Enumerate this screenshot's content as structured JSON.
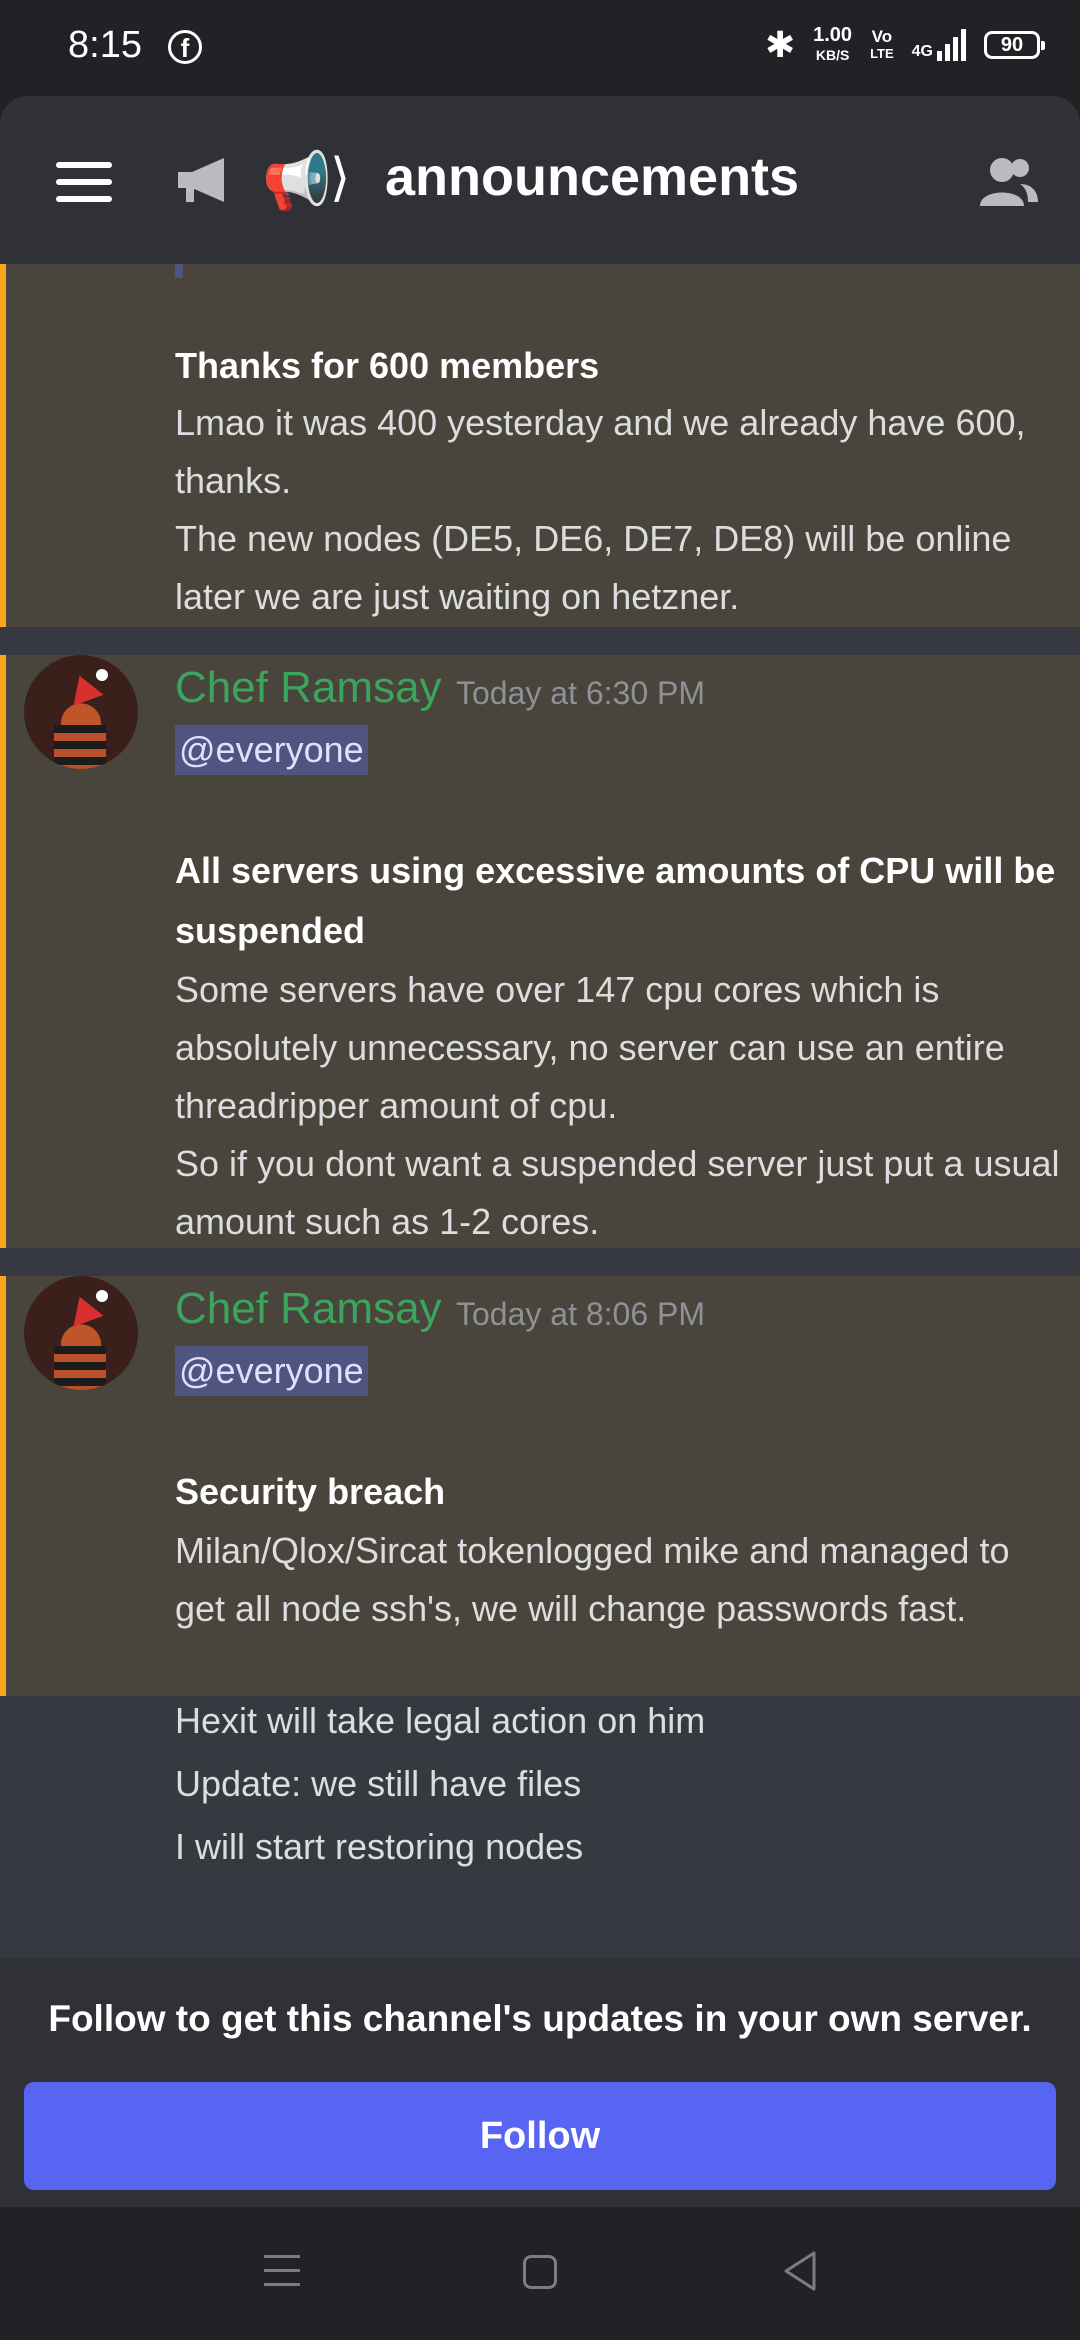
{
  "status_bar": {
    "time": "8:15",
    "fb_icon": "f",
    "speed_value": "1.00",
    "speed_unit": "KB/S",
    "volte_top": "Vo",
    "volte_bottom": "LTE",
    "network": "4G",
    "battery": "90"
  },
  "header": {
    "channel_emoji": "📢",
    "channel_chevron": "⟩",
    "channel_name": "announcements"
  },
  "messages": [
    {
      "partial": true,
      "bold": "Thanks for 600 members",
      "lines": [
        "Lmao it was 400 yesterday and we already have 600, thanks.",
        "The new nodes (DE5, DE6, DE7, DE8) will be online later we are just waiting on hetzner."
      ]
    },
    {
      "author": "Chef Ramsay",
      "timestamp": "Today at 6:30 PM",
      "mention": "@everyone",
      "bold": "All servers using excessive amounts of CPU will be suspended",
      "lines": [
        "Some servers have over 147 cpu cores which is absolutely unnecessary, no server can use an entire threadripper amount of cpu.",
        "So if you dont want a suspended server just put a usual amount such as 1-2 cores."
      ]
    },
    {
      "author": "Chef Ramsay",
      "timestamp": "Today at 8:06 PM",
      "mention": "@everyone",
      "bold": "Security breach",
      "lines": [
        "Milan/Qlox/Sircat tokenlogged mike and managed to get all node ssh's, we will change passwords fast.",
        "Hexit will take legal action on him",
        "Update: we still have files",
        "I will start restoring nodes"
      ]
    }
  ],
  "follow": {
    "prompt": "Follow to get this channel's updates in your own server.",
    "button_label": "Follow"
  },
  "icons": {
    "menu": "hamburger-icon",
    "announcement": "megaphone-icon",
    "members": "members-icon",
    "nav_menu": "recents-icon",
    "nav_home": "home-icon",
    "nav_back": "back-icon"
  },
  "colors": {
    "accent": "#5865f2",
    "author": "#3ba55d",
    "highlight_bar": "#faa81a",
    "highlight_bg": "#49443c"
  }
}
